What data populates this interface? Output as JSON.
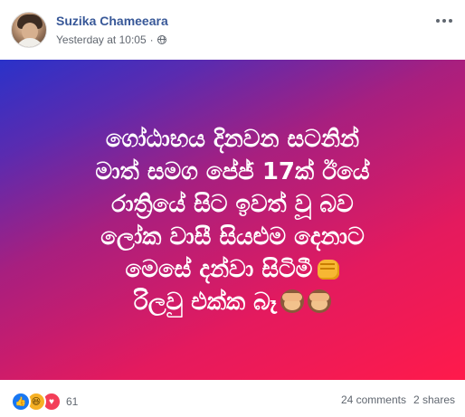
{
  "post": {
    "author": "Suzika Chameeara",
    "timestamp": "Yesterday at 10:05",
    "separator": "·",
    "audience_icon": "globe-icon",
    "image_text_lines": [
      "ගෝඨාභය දිනවන සටනින්",
      "මාත් සමග පේජ් 17ක් ඊයේ",
      "රාත්‍රියේ සිට ඉවත් වූ බව",
      "ලෝක වාසී සියළුම දෙනාට",
      "මෙසේ දන්වා සිටිමී",
      "රිලවු එක්ක බෑ"
    ],
    "image_gradient": [
      "#ff1a4b",
      "#a81f7f",
      "#2a32c9"
    ]
  },
  "footer": {
    "reaction_icons": [
      "like-icon",
      "haha-icon",
      "love-icon"
    ],
    "reaction_count": "61",
    "comments": "24 comments",
    "shares": "2 shares"
  },
  "colors": {
    "author_link": "#385898",
    "meta_text": "#616770",
    "like": "#1877f2",
    "love": "#f33e58"
  }
}
